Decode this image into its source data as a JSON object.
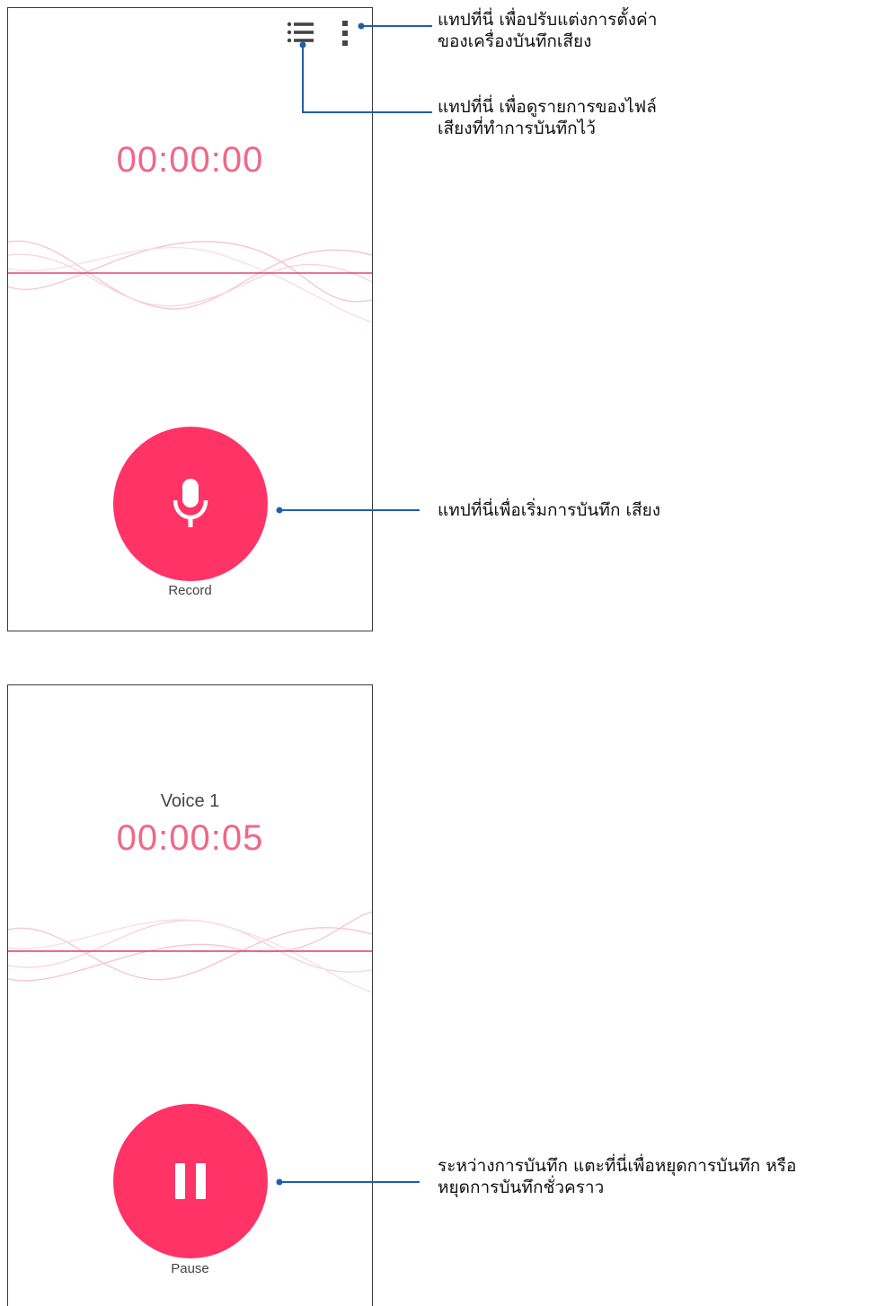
{
  "colors": {
    "accent": "#FF3366",
    "timer": "#F06787",
    "line": "#1F5FAA"
  },
  "screen_recording_idle": {
    "timer": "00:00:00",
    "button_label": "Record",
    "icons": [
      "list-icon",
      "more-vert-icon",
      "microphone-icon"
    ]
  },
  "screen_recording_active": {
    "recording_name": "Voice 1",
    "timer": "00:00:05",
    "button_label": "Pause",
    "icons": [
      "pause-icon"
    ]
  },
  "annotations": {
    "settings": [
      "แทปที่นี่ เพื่อปรับแต่งการตั้งค่า",
      "ของเครื่องบันทึกเสียง"
    ],
    "file_list": [
      "แทปที่นี่ เพื่อดูรายการของไฟล์",
      "เสียงที่ทำการบันทึกไว้"
    ],
    "record": [
      "แทปที่นี่เพื่อเริ่มการบันทึก เสียง"
    ],
    "pause": [
      "ระหว่างการบันทึก แตะที่นี่เพื่อหยุดการบันทึก หรือ",
      "หยุดการบันทึกชั่วคราว"
    ]
  }
}
